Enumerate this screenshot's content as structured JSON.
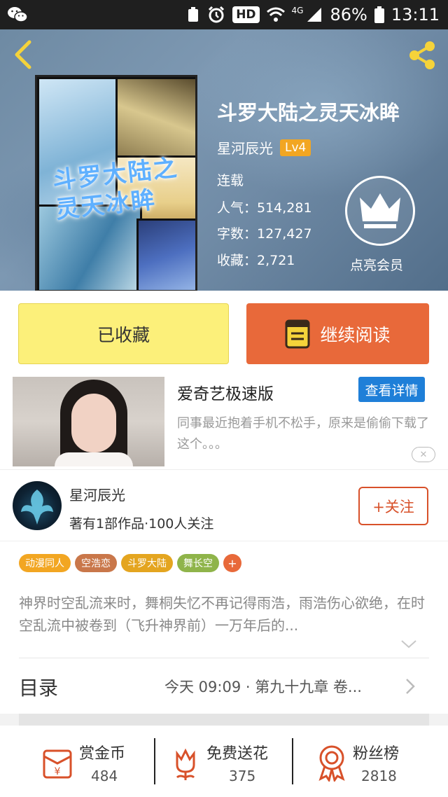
{
  "status_bar": {
    "battery": "86%",
    "time": "13:11",
    "hd": "HD",
    "network": "4G"
  },
  "book": {
    "title": "斗罗大陆之灵天冰眸",
    "author": "星河辰光",
    "level": "Lv4",
    "status": "连载",
    "popularity": "人气：514,281",
    "word_count": "字数：127,427",
    "favorites": "收藏：2,721",
    "cover_title": "斗罗大陆之\n灵天冰眸"
  },
  "vip": {
    "label": "点亮会员"
  },
  "actions": {
    "collected": "已收藏",
    "continue_reading": "继续阅读"
  },
  "ad": {
    "title": "爱奇艺极速版",
    "button": "查看详情",
    "description": "同事最近抱着手机不松手，原来是偷偷下载了这个。。。",
    "close": "✕"
  },
  "author_card": {
    "name": "星河辰光",
    "sub": "著有1部作品·100人关注",
    "follow": "+关注"
  },
  "tags": [
    {
      "label": "动漫同人",
      "color": "#f2a622"
    },
    {
      "label": "空浩恋",
      "color": "#c9774a"
    },
    {
      "label": "斗罗大陆",
      "color": "#e4a520"
    },
    {
      "label": "舞长空",
      "color": "#8fb44a"
    }
  ],
  "tags_more": "+",
  "synopsis": "神界时空乱流来时，舞桐失忆不再记得雨浩，雨浩伤心欲绝，在时空乱流中被卷到（飞升神界前）一万年后的...",
  "toc": {
    "label": "目录",
    "latest": "今天 09:09 · 第九十九章 卷..."
  },
  "stats": [
    {
      "label": "赏金币",
      "value": "484",
      "icon": "coin-envelope-icon"
    },
    {
      "label": "免费送花",
      "value": "375",
      "icon": "flower-icon"
    },
    {
      "label": "粉丝榜",
      "value": "2818",
      "icon": "medal-icon"
    }
  ],
  "colors": {
    "accent_orange": "#e8693a",
    "collected_yellow": "#fcf07a",
    "ad_blue": "#1f7fd8",
    "level_badge": "#f2a622",
    "follow_red": "#d8512a"
  }
}
